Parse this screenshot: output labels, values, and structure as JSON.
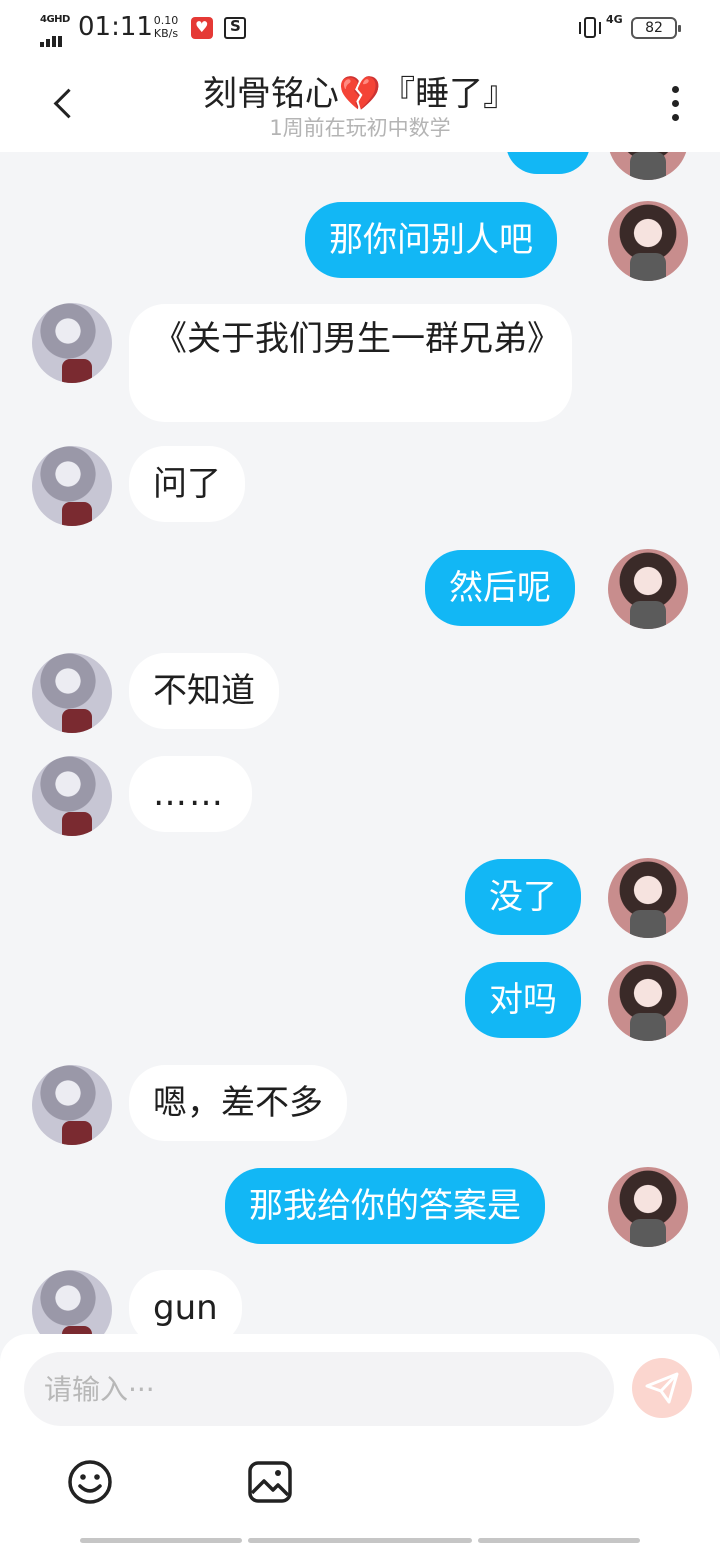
{
  "status_bar": {
    "network": "4GHD",
    "time": "01:11",
    "speed_value": "0.10",
    "speed_unit": "KB/s",
    "network_right": "4G",
    "battery": "82"
  },
  "header": {
    "title": "刻骨铭心💔『睡了』",
    "subtitle": "1周前在玩初中数学"
  },
  "messages": [
    {
      "from": "self",
      "text": ""
    },
    {
      "from": "self",
      "text": "那你问别人吧"
    },
    {
      "from": "other",
      "text": "《关于我们男生一群兄弟》"
    },
    {
      "from": "other",
      "text": "问了"
    },
    {
      "from": "self",
      "text": "然后呢"
    },
    {
      "from": "other",
      "text": "不知道"
    },
    {
      "from": "other",
      "text": "……"
    },
    {
      "from": "self",
      "text": "没了"
    },
    {
      "from": "self",
      "text": "对吗"
    },
    {
      "from": "other",
      "text": "嗯，差不多"
    },
    {
      "from": "self",
      "text": "那我给你的答案是"
    },
    {
      "from": "other",
      "text": "gun"
    }
  ],
  "input_bar": {
    "placeholder": "请输入···",
    "value": ""
  },
  "icons": {
    "back": "back-arrow-icon",
    "more": "more-vertical-icon",
    "send": "paper-plane-icon",
    "emoji": "smiley-face-icon",
    "image": "image-gallery-icon"
  },
  "colors": {
    "outgoing_bubble": "#12b7f5",
    "incoming_bubble": "#ffffff",
    "chat_background": "#f4f5f7",
    "send_button": "#fbd6cf"
  }
}
